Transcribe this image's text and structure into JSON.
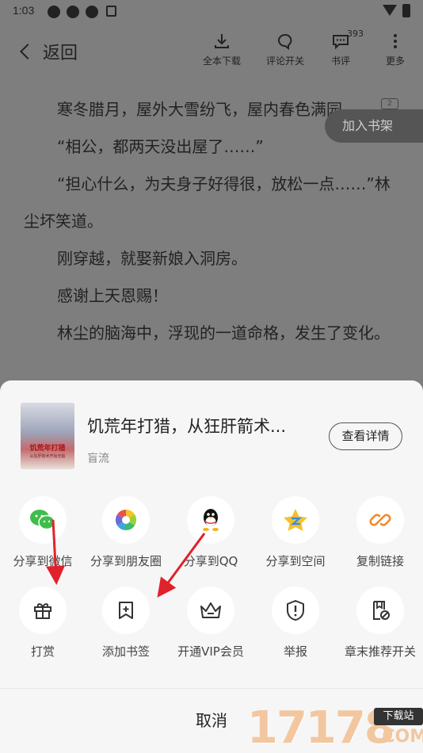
{
  "status": {
    "time": "1:03"
  },
  "topbar": {
    "back_label": "返回",
    "actions": [
      {
        "label": "全本下载",
        "icon": "download-icon"
      },
      {
        "label": "评论开关",
        "icon": "comment-toggle-icon"
      },
      {
        "label": "书评",
        "icon": "review-icon",
        "badge": "393"
      },
      {
        "label": "更多",
        "icon": "more-vertical-icon"
      }
    ]
  },
  "reader": {
    "paragraphs": [
      "寒冬腊月，屋外大雪纷飞，屋内春色满园。",
      "“相公，都两天没出屋了……”",
      "“担心什么，为夫身子好得很，放松一点……”林尘坏笑道。",
      "刚穿越，就娶新娘入洞房。",
      "感谢上天恩赐！",
      "林尘的脑海中，浮现的一道命格，发生了变化。"
    ],
    "page_tag": "2",
    "add_shelf_label": "加入书架"
  },
  "sheet": {
    "book": {
      "title": "饥荒年打猎，从狂肝箭术...",
      "author": "盲流",
      "cover_title": "饥荒年打猎",
      "cover_sub": "从狂肝箭术开始无敌",
      "detail_button": "查看详情"
    },
    "share_row": [
      {
        "label": "分享到微信",
        "icon": "wechat-icon"
      },
      {
        "label": "分享到朋友圈",
        "icon": "moments-icon"
      },
      {
        "label": "分享到QQ",
        "icon": "qq-icon"
      },
      {
        "label": "分享到空间",
        "icon": "qzone-icon"
      },
      {
        "label": "复制链接",
        "icon": "link-icon"
      }
    ],
    "action_row": [
      {
        "label": "打赏",
        "icon": "gift-icon"
      },
      {
        "label": "添加书签",
        "icon": "bookmark-add-icon"
      },
      {
        "label": "开通VIP会员",
        "icon": "crown-icon"
      },
      {
        "label": "举报",
        "icon": "report-shield-icon"
      },
      {
        "label": "章末推荐开关",
        "icon": "chapter-recommend-icon"
      }
    ],
    "cancel_label": "取消"
  },
  "watermark": {
    "number": "17178",
    "tag": "下载站",
    "domain": ".COM"
  },
  "colors": {
    "accent_red": "#e0222a",
    "sheet_bg": "#f6f6f6",
    "dim_overlay": "#7e7e7e"
  }
}
